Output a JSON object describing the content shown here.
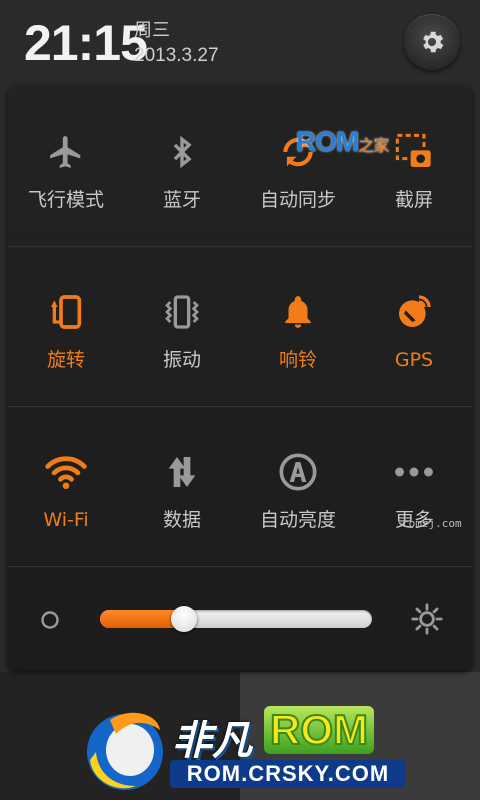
{
  "status": {
    "time": "21:15",
    "weekday": "周三",
    "date": "2013.3.27"
  },
  "watermark": {
    "top_rom": "ROM",
    "top_zhijia": "之家",
    "site": "romzj.com"
  },
  "toggles": [
    {
      "label": "飞行模式",
      "icon": "airplane-icon",
      "on": false
    },
    {
      "label": "蓝牙",
      "icon": "bluetooth-icon",
      "on": false
    },
    {
      "label": "自动同步",
      "icon": "sync-icon",
      "on": false
    },
    {
      "label": "截屏",
      "icon": "screenshot-icon",
      "on": false
    },
    {
      "label": "旋转",
      "icon": "rotate-icon",
      "on": true
    },
    {
      "label": "振动",
      "icon": "vibrate-icon",
      "on": false
    },
    {
      "label": "响铃",
      "icon": "bell-icon",
      "on": true
    },
    {
      "label": "GPS",
      "icon": "gps-icon",
      "on": true
    },
    {
      "label": "Wi-Fi",
      "icon": "wifi-icon",
      "on": true
    },
    {
      "label": "数据",
      "icon": "data-icon",
      "on": false
    },
    {
      "label": "自动亮度",
      "icon": "auto-brightness-icon",
      "on": false
    },
    {
      "label": "更多",
      "icon": "more-icon",
      "on": false
    }
  ],
  "brightness": {
    "level": 0.31
  },
  "colors": {
    "accent": "#f07d1a",
    "inactive": "#c8c8c8",
    "panel": "#1f1f1f"
  },
  "bottom_logo": {
    "name": "非凡",
    "rom": "ROM",
    "url": "ROM.CRSKY.COM"
  }
}
